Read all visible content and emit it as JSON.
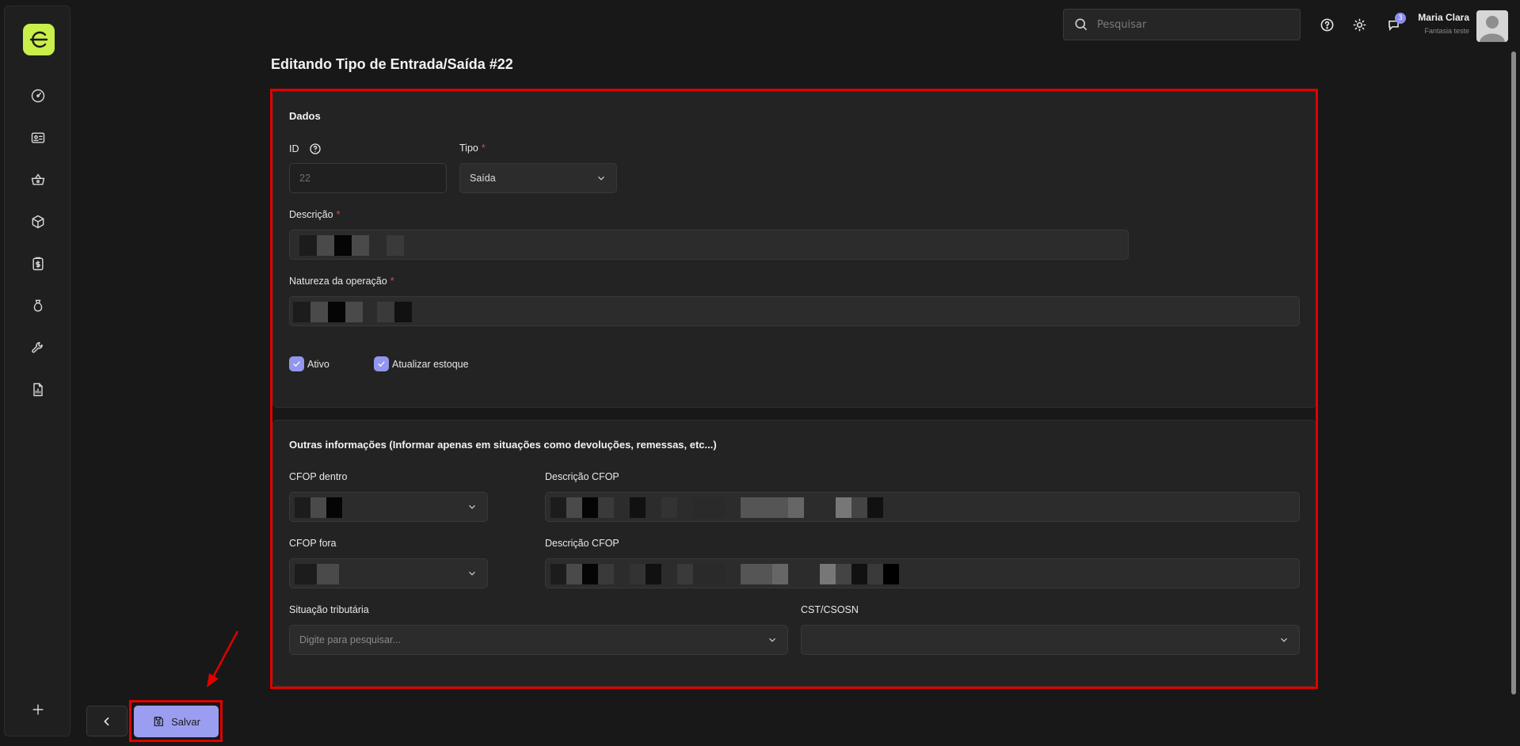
{
  "colors": {
    "accent": "#9b9ef0",
    "logo": "#c9ef4b",
    "highlight": "#e00000",
    "required": "#e04848"
  },
  "sidebar": {
    "logo_letter": "e",
    "items": [
      {
        "icon": "dashboard-icon"
      },
      {
        "icon": "id-card-icon"
      },
      {
        "icon": "basket-icon"
      },
      {
        "icon": "package-icon"
      },
      {
        "icon": "clipboard-dollar-icon"
      },
      {
        "icon": "money-bag-icon"
      },
      {
        "icon": "wrench-icon"
      },
      {
        "icon": "report-icon"
      }
    ],
    "add_icon": "plus-icon"
  },
  "topbar": {
    "search_placeholder": "Pesquisar",
    "notification_count": "3",
    "user_name": "Maria Clara",
    "user_company": "Fantasia teste"
  },
  "page": {
    "title": "Editando Tipo de Entrada/Saída #22"
  },
  "dados": {
    "section_title": "Dados",
    "id_label": "ID",
    "id_value": "22",
    "tipo_label": "Tipo",
    "tipo_value": "Saída",
    "required_mark": "*",
    "descricao_label": "Descrição",
    "natureza_label": "Natureza da operação",
    "ativo_label": "Ativo",
    "ativo_checked": true,
    "estoque_label": "Atualizar estoque",
    "estoque_checked": true
  },
  "outras": {
    "section_title": "Outras informações (Informar apenas em situações como devoluções, remessas, etc...)",
    "cfop_dentro_label": "CFOP dentro",
    "descricao_cfop_label": "Descrição CFOP",
    "cfop_fora_label": "CFOP fora",
    "descricao_cfop_fora_label": "Descrição CFOP",
    "situacao_label": "Situação tributária",
    "situacao_placeholder": "Digite para pesquisar...",
    "cst_label": "CST/CSOSN"
  },
  "actions": {
    "save_label": "Salvar"
  }
}
